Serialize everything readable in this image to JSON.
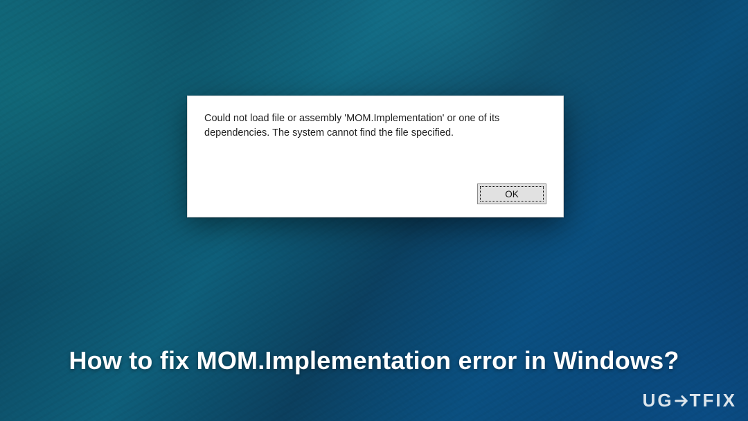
{
  "dialog": {
    "message": "Could not load file or assembly 'MOM.Implementation' or one of its dependencies. The system cannot find the file specified.",
    "ok_label": "OK"
  },
  "headline": "How to fix MOM.Implementation error in Windows?",
  "brand": {
    "prefix": "UG",
    "suffix": "TFIX"
  }
}
